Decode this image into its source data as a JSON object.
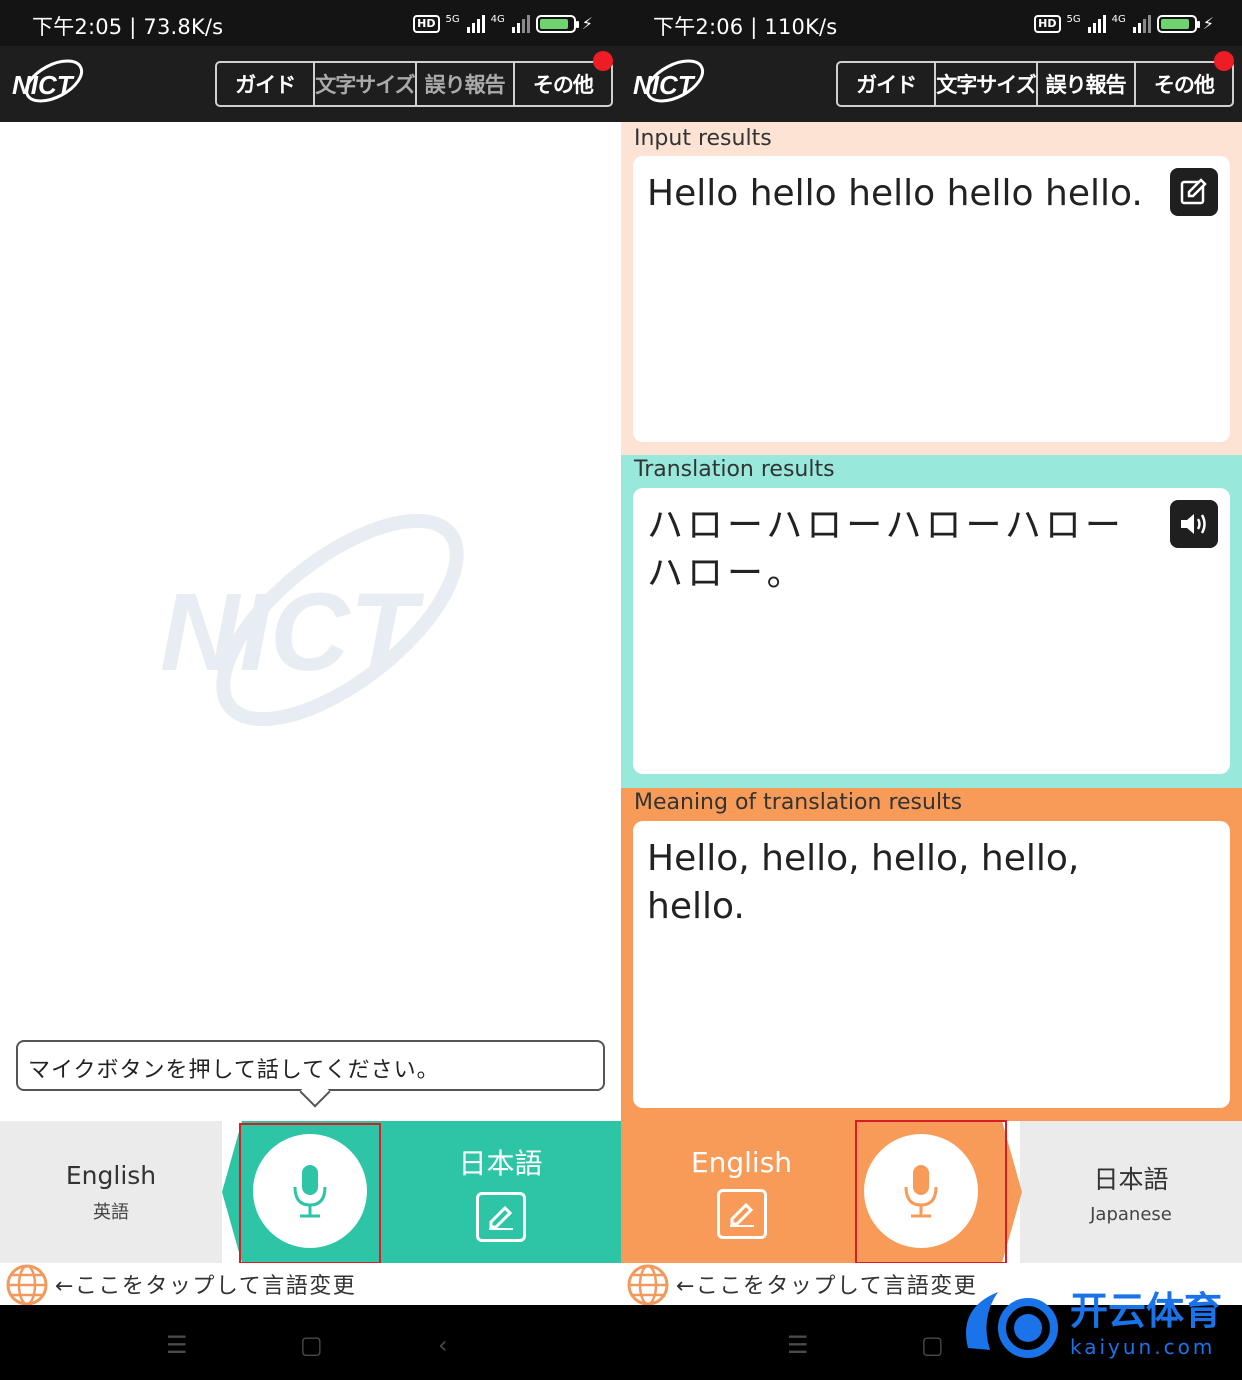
{
  "left": {
    "status": {
      "time_speed": "下午2:05 | 73.8K/s",
      "net1": "5G",
      "net2": "4G",
      "battery": "76"
    },
    "menu": {
      "guide": "ガイド",
      "font_size": "文字サイズ",
      "report": "誤り報告",
      "other": "その他"
    },
    "logo_text": "NICT",
    "hint": "マイクボタンを押して話してください。",
    "lang_source": {
      "name": "English",
      "sub": "英語"
    },
    "lang_target": {
      "name": "日本語"
    },
    "tap_hint": "←ここをタップして言語変更"
  },
  "right": {
    "status": {
      "time_speed": "下午2:06 | 110K/s",
      "net1": "5G",
      "net2": "4G",
      "battery": "76"
    },
    "menu": {
      "guide": "ガイド",
      "font_size": "文字サイズ",
      "report": "誤り報告",
      "other": "その他"
    },
    "logo_text": "NICT",
    "input": {
      "title": "Input results",
      "text": "Hello hello hello hello hello."
    },
    "translation": {
      "title": "Translation results",
      "text": "ハローハローハローハローハロー。"
    },
    "meaning": {
      "title": "Meaning of translation results",
      "text": "Hello, hello, hello, hello, hello."
    },
    "lang_source": {
      "name": "English"
    },
    "lang_target": {
      "name": "日本語",
      "sub": "Japanese"
    },
    "tap_hint": "←ここをタップして言語変更"
  },
  "watermark": {
    "cn": "开云体育",
    "en": "kaiyun.com"
  },
  "colors": {
    "teal": "#2ec4a6",
    "orange": "#f99b58",
    "peach": "#fde3d4",
    "mint": "#98e9db",
    "bar_gray": "#ebebeb"
  }
}
